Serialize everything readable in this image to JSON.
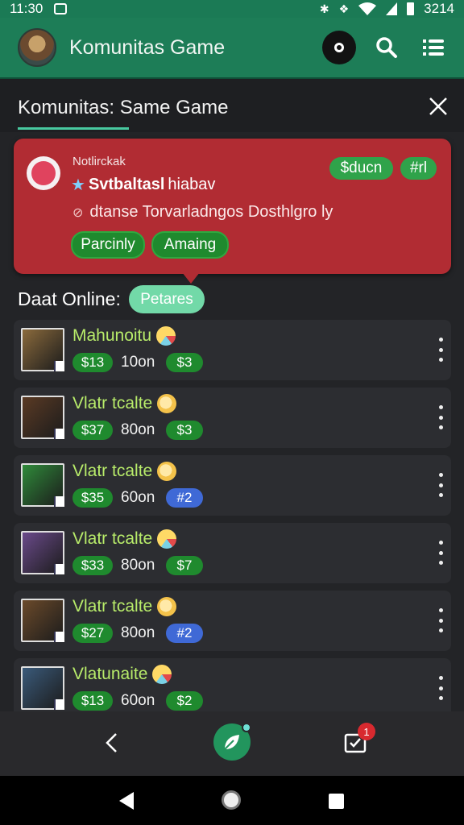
{
  "status_bar": {
    "time": "11:30",
    "right_text": "3214"
  },
  "app_bar": {
    "title": "Komunitas Game"
  },
  "sub_header": {
    "title": "Komunitas: Same Game"
  },
  "notification": {
    "small_label": "Notlirckak",
    "headline_bold": "Svtbaltasl",
    "headline_rest": " hiabav",
    "body": "dtanse Torvarladngos Dosthlgro ly",
    "tag_1": "$ducn",
    "tag_2": "#rl",
    "button_1": "Parcinly",
    "button_2": "Amaing",
    "color": "#b12c33"
  },
  "online": {
    "label": "Daat Online:",
    "chip": "Petares"
  },
  "list": [
    {
      "name": "Mahunoitu",
      "price": "$13",
      "time": "10on",
      "rank": "$3",
      "rank_color": "green",
      "thumb_color": "#8a6a3c",
      "emoji": "alt"
    },
    {
      "name": "Vlatr tcalte",
      "price": "$37",
      "time": "80on",
      "rank": "$3",
      "rank_color": "green",
      "thumb_color": "#5a3a24",
      "emoji": "plain"
    },
    {
      "name": "Vlatr tcalte",
      "price": "$35",
      "time": "60on",
      "rank": "#2",
      "rank_color": "blue",
      "thumb_color": "#2f8a3a",
      "emoji": "plain"
    },
    {
      "name": "Vlatr tcalte",
      "price": "$33",
      "time": "80on",
      "rank": "$7",
      "rank_color": "green",
      "thumb_color": "#6a4a8a",
      "emoji": "alt"
    },
    {
      "name": "Vlatr tcalte",
      "price": "$27",
      "time": "80on",
      "rank": "#2",
      "rank_color": "blue",
      "thumb_color": "#6b4a2a",
      "emoji": "plain"
    },
    {
      "name": "Vlatunaite",
      "price": "$13",
      "time": "60on",
      "rank": "$2",
      "rank_color": "green",
      "thumb_color": "#3a5a7a",
      "emoji": "alt"
    }
  ],
  "bottom_nav": {
    "mail_badge": "1"
  },
  "colors": {
    "accent": "#1d7d57",
    "card": "#2c2d31",
    "price_green": "#1f8a2e",
    "rank_blue": "#3f69d6",
    "name_green": "#b8ec6a"
  }
}
